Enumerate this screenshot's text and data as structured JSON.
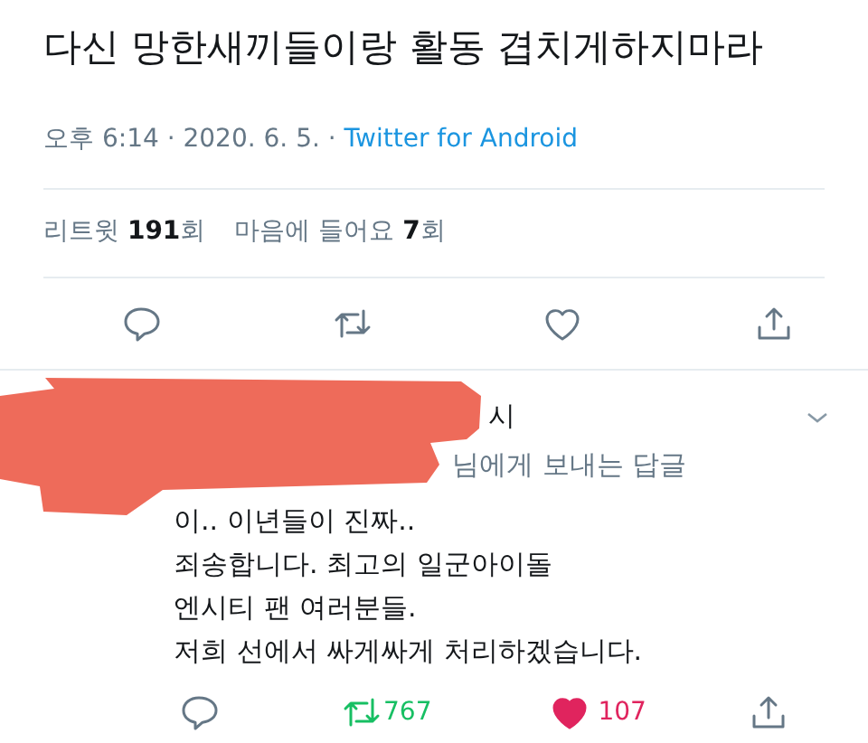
{
  "tweet": {
    "text": "다신 망한새끼들이랑 활동 겹치게하지마라",
    "time": "오후 6:14 · 2020. 6. 5. · ",
    "source": "Twitter for Android",
    "stats": [
      {
        "label": "리트윗",
        "count": "191",
        "unit": "회"
      },
      {
        "label": "마음에 들어요",
        "count": "7",
        "unit": "회"
      }
    ],
    "actions": {
      "retweeted": false,
      "liked": false
    }
  },
  "reply": {
    "redacted": true,
    "name_tail": "시",
    "replying_to": "님에게 보내는 답글",
    "lines": [
      "이.. 이년들이 진짜..",
      "죄송합니다. 최고의 일군아이돌",
      "엔시티 팬 여러분들.",
      "저희 선에서 싸게싸게 처리하겠습니다."
    ],
    "retweet_count": "767",
    "like_count": "107",
    "retweeted": true,
    "liked": true
  }
}
